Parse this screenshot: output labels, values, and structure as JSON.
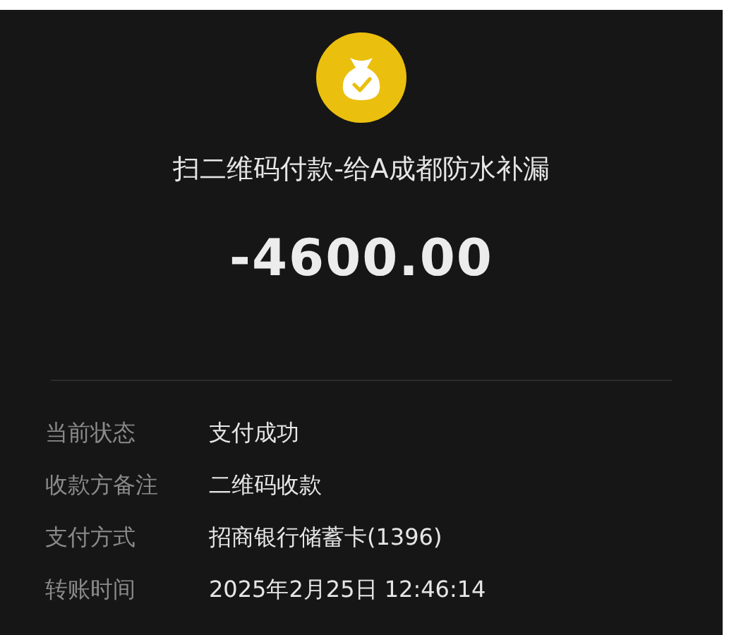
{
  "title": "扫二维码付款-给A成都防水补漏",
  "amount": "-4600.00",
  "details": [
    {
      "label": "当前状态",
      "value": "支付成功"
    },
    {
      "label": "收款方备注",
      "value": "二维码收款"
    },
    {
      "label": "支付方式",
      "value": "招商银行储蓄卡(1396)"
    },
    {
      "label": "转账时间",
      "value": "2025年2月25日 12:46:14"
    }
  ]
}
